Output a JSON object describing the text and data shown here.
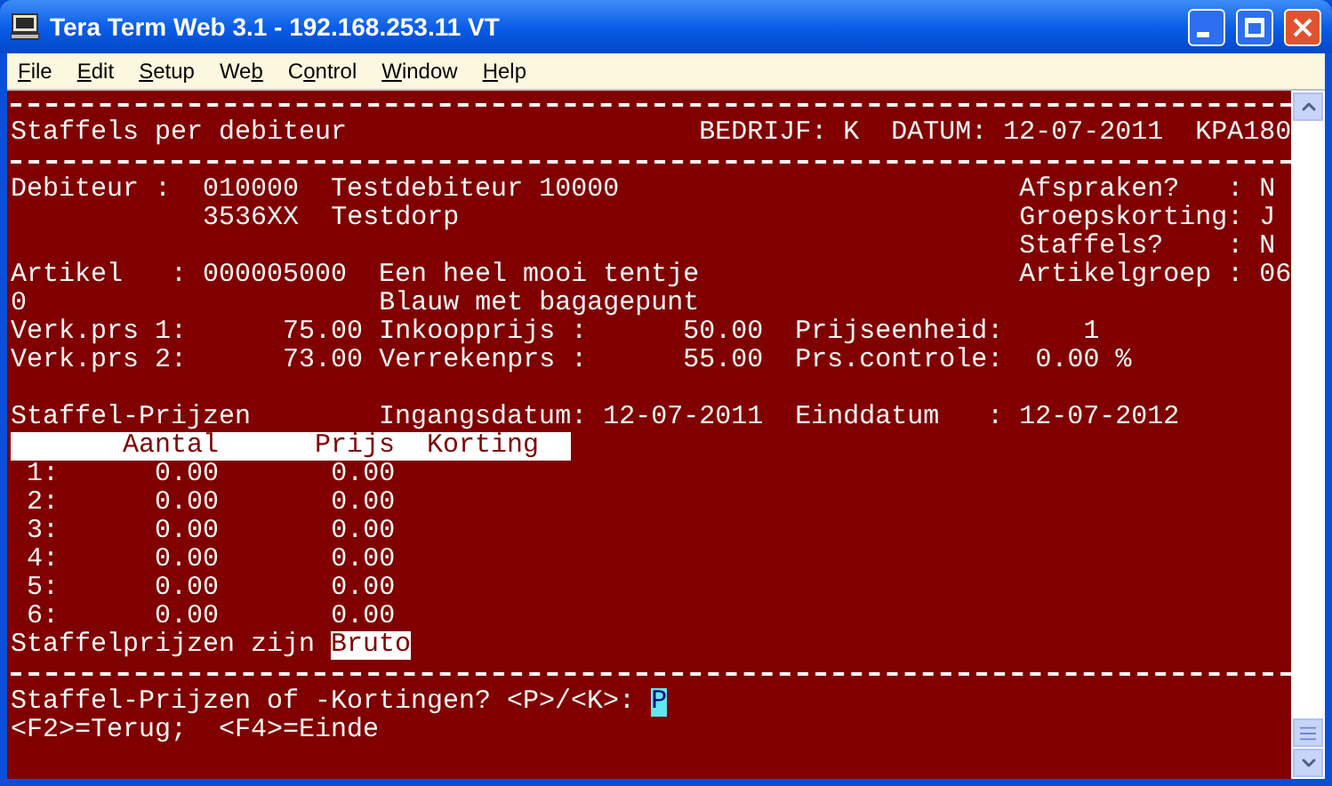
{
  "window": {
    "title": "Tera Term Web 3.1 - 192.168.253.11 VT"
  },
  "menu": [
    {
      "accelerator": "F",
      "after": "ile"
    },
    {
      "accelerator": "E",
      "after": "dit"
    },
    {
      "accelerator": "S",
      "after": "etup"
    },
    {
      "before": "We",
      "accelerator": "b"
    },
    {
      "before": "C",
      "accelerator": "o",
      "after": "ntrol"
    },
    {
      "accelerator": "W",
      "after": "indow"
    },
    {
      "accelerator": "H",
      "after": "elp"
    }
  ],
  "terminal": {
    "lines": [
      {
        "kind": "rule"
      },
      {
        "kind": "text",
        "segments": [
          {
            "kind": "plain",
            "text": "Staffels per debiteur"
          },
          {
            "kind": "plain",
            "text": "                      BEDRIJF: K"
          },
          {
            "kind": "plain",
            "text": "  DATUM: 12-07-2011"
          },
          {
            "kind": "plain",
            "text": "  KPA180"
          }
        ]
      },
      {
        "kind": "rule"
      },
      {
        "kind": "text",
        "segments": [
          {
            "kind": "plain",
            "text": "Debiteur :  010000"
          },
          {
            "kind": "plain",
            "text": "  Testdebiteur 10000"
          },
          {
            "kind": "plain",
            "text": "                         Afspraken?   : N"
          }
        ]
      },
      {
        "kind": "text",
        "segments": [
          {
            "kind": "plain",
            "text": "            3536XX"
          },
          {
            "kind": "plain",
            "text": "  Testdorp"
          },
          {
            "kind": "plain",
            "text": "                                   Groepskorting: J"
          }
        ]
      },
      {
        "kind": "text",
        "segments": [
          {
            "kind": "plain",
            "text": "                                                               Staffels?    : N"
          }
        ]
      },
      {
        "kind": "text",
        "segments": [
          {
            "kind": "plain",
            "text": "Artikel   : 000005000"
          },
          {
            "kind": "plain",
            "text": "  Een heel mooi tentje"
          },
          {
            "kind": "plain",
            "text": "                    Artikelgroep : 06"
          }
        ]
      },
      {
        "kind": "text",
        "segments": [
          {
            "kind": "plain",
            "text": "0"
          },
          {
            "kind": "plain",
            "text": "                      Blauw met bagagepunt"
          }
        ]
      },
      {
        "kind": "text",
        "segments": [
          {
            "kind": "plain",
            "text": "Verk.prs 1:"
          },
          {
            "kind": "plain",
            "text": "      75.00"
          },
          {
            "kind": "plain",
            "text": " Inkoopprijs :"
          },
          {
            "kind": "plain",
            "text": "      50.00"
          },
          {
            "kind": "plain",
            "text": "  Prijseenheid:"
          },
          {
            "kind": "plain",
            "text": "     1"
          }
        ]
      },
      {
        "kind": "text",
        "segments": [
          {
            "kind": "plain",
            "text": "Verk.prs 2:"
          },
          {
            "kind": "plain",
            "text": "      73.00"
          },
          {
            "kind": "plain",
            "text": " Verrekenprs :"
          },
          {
            "kind": "plain",
            "text": "      55.00"
          },
          {
            "kind": "plain",
            "text": "  Prs.controle:"
          },
          {
            "kind": "plain",
            "text": "  0.00 %"
          }
        ]
      },
      {
        "kind": "blank"
      },
      {
        "kind": "text",
        "segments": [
          {
            "kind": "plain",
            "text": "Staffel-Prijzen"
          },
          {
            "kind": "plain",
            "text": "        Ingangsdatum: 12-07-2011"
          },
          {
            "kind": "plain",
            "text": "  Einddatum   : 12-07-2012"
          }
        ]
      },
      {
        "kind": "text",
        "segments": [
          {
            "kind": "band",
            "text": "       Aantal      Prijs  Korting"
          }
        ]
      },
      {
        "kind": "text",
        "segments": [
          {
            "kind": "plain",
            "text": " 1:"
          },
          {
            "kind": "plain",
            "text": "      0.00"
          },
          {
            "kind": "plain",
            "text": "       0.00"
          }
        ]
      },
      {
        "kind": "text",
        "segments": [
          {
            "kind": "plain",
            "text": " 2:"
          },
          {
            "kind": "plain",
            "text": "      0.00"
          },
          {
            "kind": "plain",
            "text": "       0.00"
          }
        ]
      },
      {
        "kind": "text",
        "segments": [
          {
            "kind": "plain",
            "text": " 3:"
          },
          {
            "kind": "plain",
            "text": "      0.00"
          },
          {
            "kind": "plain",
            "text": "       0.00"
          }
        ]
      },
      {
        "kind": "text",
        "segments": [
          {
            "kind": "plain",
            "text": " 4:"
          },
          {
            "kind": "plain",
            "text": "      0.00"
          },
          {
            "kind": "plain",
            "text": "       0.00"
          }
        ]
      },
      {
        "kind": "text",
        "segments": [
          {
            "kind": "plain",
            "text": " 5:"
          },
          {
            "kind": "plain",
            "text": "      0.00"
          },
          {
            "kind": "plain",
            "text": "       0.00"
          }
        ]
      },
      {
        "kind": "text",
        "segments": [
          {
            "kind": "plain",
            "text": " 6:"
          },
          {
            "kind": "plain",
            "text": "      0.00"
          },
          {
            "kind": "plain",
            "text": "       0.00"
          }
        ]
      },
      {
        "kind": "text",
        "segments": [
          {
            "kind": "plain",
            "text": "Staffelprijzen zijn"
          },
          {
            "kind": "inverse",
            "text": " Bruto"
          }
        ]
      },
      {
        "kind": "rule"
      },
      {
        "kind": "text",
        "segments": [
          {
            "kind": "plain",
            "text": "Staffel-Prijzen of -Kortingen? <P>/<K>:"
          },
          {
            "kind": "cursor",
            "text": " P"
          }
        ]
      },
      {
        "kind": "text",
        "segments": [
          {
            "kind": "plain",
            "text": "<F2>=Terug;  <F4>=Einde"
          }
        ]
      }
    ]
  }
}
